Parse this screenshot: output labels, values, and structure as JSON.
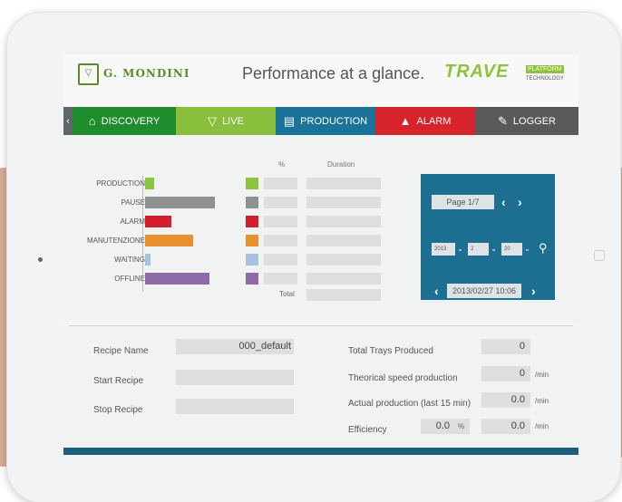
{
  "brand": {
    "logo_text": "G. MONDINI",
    "tagline": "Performance at a glance.",
    "partner": "TRAVE",
    "partner_badge": "PLATFORM",
    "partner_sub": "TECHNOLOGY"
  },
  "tabs": [
    {
      "label": "DISCOVERY",
      "icon": "home-icon",
      "color": "#1f8c2e"
    },
    {
      "label": "LIVE",
      "icon": "mondini-icon",
      "color": "#8abe3d"
    },
    {
      "label": "PRODUCTION",
      "icon": "clipboard-icon",
      "color": "#1b7399"
    },
    {
      "label": "ALARM",
      "icon": "warning-icon",
      "color": "#d7232c"
    },
    {
      "label": "LOGGER",
      "icon": "pen-icon",
      "color": "#595959"
    }
  ],
  "summary": {
    "col_percent": "%",
    "col_duration": "Duration",
    "total_label": "Total",
    "categories": [
      {
        "label": "PRODUCTION",
        "color": "#8cc43e",
        "bar_fraction": 0.1
      },
      {
        "label": "PAUSE",
        "color": "#8e9092",
        "bar_fraction": 0.75
      },
      {
        "label": "ALARM",
        "color": "#d21f2b",
        "bar_fraction": 0.28
      },
      {
        "label": "MANUTENZIONE",
        "color": "#e7902d",
        "bar_fraction": 0.52
      },
      {
        "label": "WAITING",
        "color": "#a8c1de",
        "bar_fraction": 0.06
      },
      {
        "label": "OFFLINE",
        "color": "#8e6aa8",
        "bar_fraction": 0.7
      }
    ]
  },
  "navigator": {
    "page": "Page 1/7",
    "year": "2013",
    "month": "2",
    "day": "20",
    "datetime": "2013/02/27 10:06"
  },
  "details": {
    "recipe_name_label": "Recipe Name",
    "recipe_name_value": "000_default",
    "start_recipe_label": "Start Recipe",
    "stop_recipe_label": "Stop Recipe",
    "total_trays_label": "Total Trays Produced",
    "total_trays_value": "0",
    "theoretical_label": "Theorical speed production",
    "theoretical_value": "0",
    "theoretical_unit": "/min",
    "actual_label": "Actual production (last 15 min)",
    "actual_value": "0.0",
    "actual_unit": "/min",
    "efficiency_label": "Efficiency",
    "efficiency_pct_value": "0.0",
    "efficiency_pct_unit": "%",
    "efficiency_value": "0.0",
    "efficiency_unit": "/min"
  }
}
